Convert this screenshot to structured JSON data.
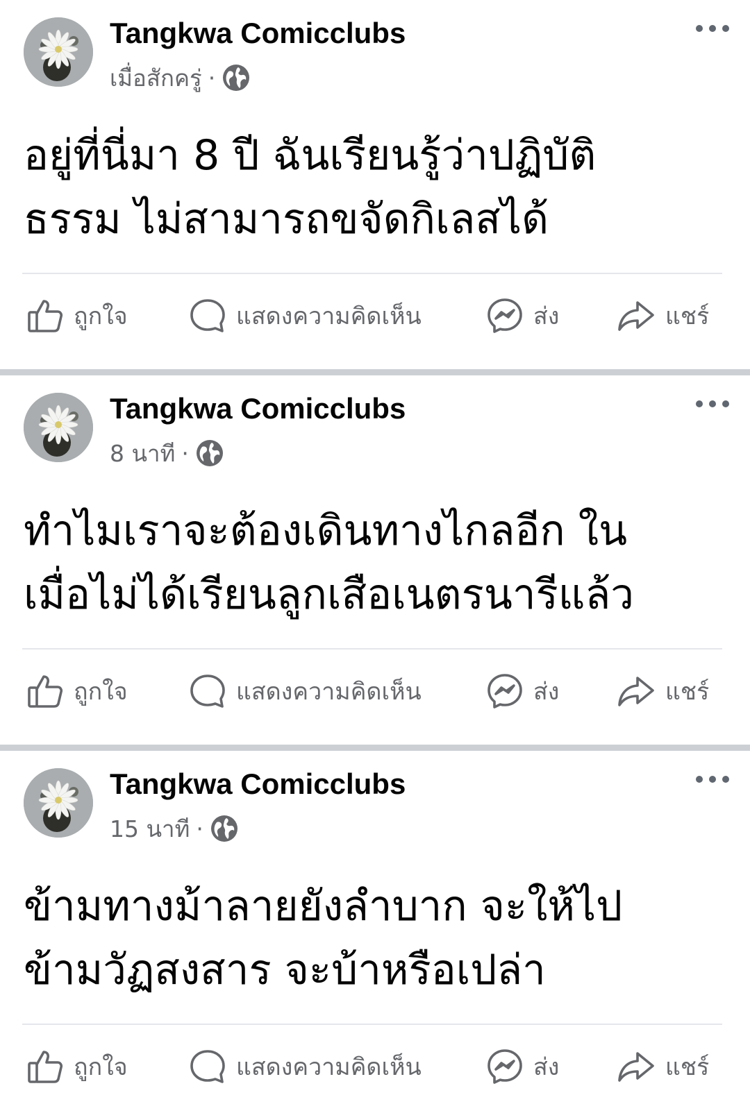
{
  "posts": [
    {
      "author": "Tangkwa Comicclubs",
      "time": "เมื่อสักครู่",
      "separator": "·",
      "lines": [
        "อยู่ที่นี่มา 8 ปี ฉันเรียนรู้ว่าปฏิบัติ",
        "ธรรม ไม่สามารถขจัดกิเลสได้"
      ]
    },
    {
      "author": "Tangkwa Comicclubs",
      "time": "8 นาที",
      "separator": "·",
      "lines": [
        "ทำไมเราจะต้องเดินทางไกลอีก ใน",
        "เมื่อไม่ได้เรียนลูกเสือเนตรนารีแล้ว"
      ]
    },
    {
      "author": "Tangkwa Comicclubs",
      "time": "15 นาที",
      "separator": "·",
      "lines": [
        "ข้ามทางม้าลายยังลำบาก จะให้ไป",
        "ข้ามวัฏสงสาร จะบ้าหรือเปล่า"
      ]
    }
  ],
  "actions": {
    "like": "ถูกใจ",
    "comment": "แสดงความคิดเห็น",
    "send": "ส่ง",
    "share": "แชร์"
  },
  "icons": {
    "audience": "globe-icon",
    "more": "more-options-icon",
    "like": "thumbs-up-icon",
    "comment": "comment-bubble-icon",
    "send": "messenger-icon",
    "share": "share-arrow-icon"
  },
  "colors": {
    "text": "#050505",
    "secondary": "#65676b",
    "divider": "#e4e6eb",
    "separator_band": "#ccd0d5"
  }
}
